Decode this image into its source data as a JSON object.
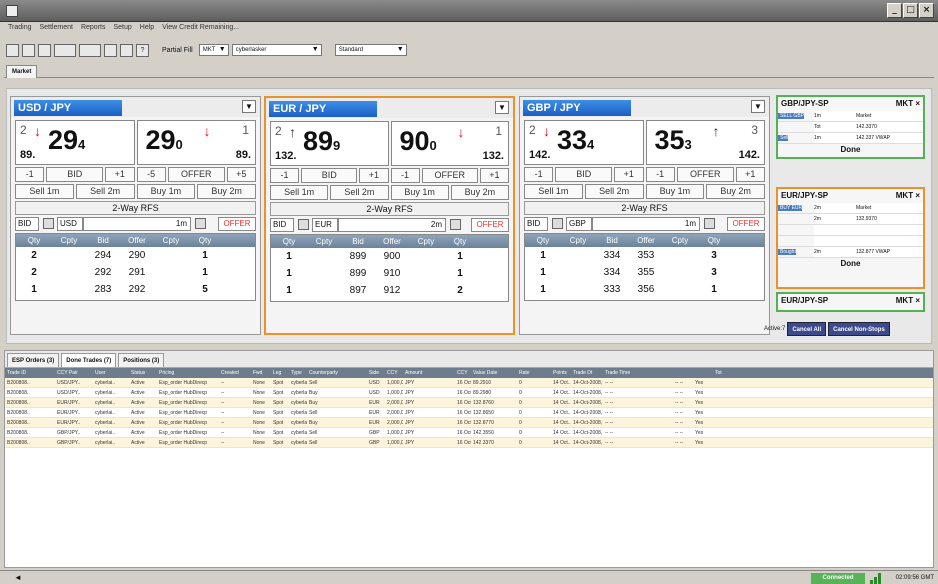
{
  "window": {
    "close": "×",
    "minimize": "_",
    "maximize": "□"
  },
  "menu": [
    "Trading",
    "Settlement",
    "Reports",
    "Setup",
    "Help",
    "View Credit Remaining..."
  ],
  "toolbar": {
    "partial_fill_label": "Partial Fill",
    "partial_fill_value": "MKT",
    "user": "cyberlasker",
    "mode": "Standard"
  },
  "market_tab": "Market",
  "tiles": [
    {
      "pair": "USD / JPY",
      "bid": {
        "top": "2",
        "big": "29",
        "small": "4",
        "base": "89."
      },
      "ask": {
        "top": "1",
        "big": "29",
        "small": "0",
        "base": "89."
      },
      "row1": [
        "-1",
        "BID",
        "+1",
        "-5",
        "OFFER",
        "+5"
      ],
      "row2": [
        "Sell 1m",
        "Sell 2m",
        "Buy 1m",
        "Buy 2m"
      ],
      "rfs": "2-Way RFS",
      "bid_lbl": "BID",
      "ccy": "USD",
      "amt": "1m",
      "offer_lbl": "OFFER",
      "grid_head": [
        "Qty",
        "Cpty",
        "Bid",
        "Offer",
        "Cpty",
        "Qty"
      ],
      "rows": [
        [
          "2",
          "",
          "294",
          "290",
          "",
          "1"
        ],
        [
          "2",
          "",
          "292",
          "291",
          "",
          "1"
        ],
        [
          "1",
          "",
          "283",
          "292",
          "",
          "5"
        ]
      ],
      "bid_dir": "down",
      "ask_dir": "down"
    },
    {
      "pair": "EUR / JPY",
      "bid": {
        "top": "2",
        "big": "89",
        "small": "9",
        "base": "132."
      },
      "ask": {
        "top": "1",
        "big": "90",
        "small": "0",
        "base": "132."
      },
      "row1": [
        "-1",
        "BID",
        "+1",
        "-1",
        "OFFER",
        "+1"
      ],
      "row2": [
        "Sell 1m",
        "Sell 2m",
        "Buy 1m",
        "Buy 2m"
      ],
      "rfs": "2-Way RFS",
      "bid_lbl": "BID",
      "ccy": "EUR",
      "amt": "2m",
      "offer_lbl": "OFFER",
      "grid_head": [
        "Qty",
        "Cpty",
        "Bid",
        "Offer",
        "Cpty",
        "Qty"
      ],
      "rows": [
        [
          "1",
          "",
          "899",
          "900",
          "",
          "1"
        ],
        [
          "1",
          "",
          "899",
          "910",
          "",
          "1"
        ],
        [
          "1",
          "",
          "897",
          "912",
          "",
          "2"
        ]
      ],
      "bid_dir": "up",
      "ask_dir": "down"
    },
    {
      "pair": "GBP / JPY",
      "bid": {
        "top": "2",
        "big": "33",
        "small": "4",
        "base": "142."
      },
      "ask": {
        "top": "3",
        "big": "35",
        "small": "3",
        "base": "142."
      },
      "row1": [
        "-1",
        "BID",
        "+1",
        "-1",
        "OFFER",
        "+1"
      ],
      "row2": [
        "Sell 1m",
        "Sell 2m",
        "Buy 1m",
        "Buy 2m"
      ],
      "rfs": "2-Way RFS",
      "bid_lbl": "BID",
      "ccy": "GBP",
      "amt": "1m",
      "offer_lbl": "OFFER",
      "grid_head": [
        "Qty",
        "Cpty",
        "Bid",
        "Offer",
        "Cpty",
        "Qty"
      ],
      "rows": [
        [
          "1",
          "",
          "334",
          "353",
          "",
          "3"
        ],
        [
          "1",
          "",
          "334",
          "355",
          "",
          "3"
        ],
        [
          "1",
          "",
          "333",
          "356",
          "",
          "1"
        ]
      ],
      "bid_dir": "down",
      "ask_dir": "up"
    }
  ],
  "minis": [
    {
      "title": "GBP/JPY-SP",
      "type": "MKT ×",
      "tag1": "SELL GBP",
      "r1": [
        "1m",
        "Market"
      ],
      "r2": [
        "Tot",
        "142.3370"
      ],
      "tag2": "Sell",
      "r3": [
        "1m",
        "142.337 VWAP"
      ],
      "done": "Done"
    },
    {
      "title": "EUR/JPY-SP",
      "type": "MKT ×",
      "tag1": "BUY EUR",
      "r1": [
        "2m",
        "Market"
      ],
      "r2": [
        "2m",
        "132.9370"
      ],
      "tag2": "Bought",
      "r3": [
        "2m",
        "132.877 VWAP"
      ],
      "done": "Done"
    },
    {
      "title": "EUR/JPY-SP",
      "type": "MKT ×"
    }
  ],
  "actions": {
    "active": "Active:7",
    "cancel_all": "Cancel All",
    "cancel_non_stops": "Cancel Non-Stops"
  },
  "lower_tabs": [
    "ESP Orders (3)",
    "Done Trades (7)",
    "Positions (3)"
  ],
  "trades_head": [
    "Trade ID",
    "CCY Pair",
    "User",
    "Status",
    "Pricing",
    "Created",
    "Fwd",
    "Leg",
    "Type",
    "Counterparty",
    "Side",
    "CCY",
    "Amount",
    "CCY",
    "Value Date",
    "Rate",
    "Points",
    "Trade Dt",
    "Trade Time",
    "",
    "",
    "Tot"
  ],
  "trades": [
    [
      "B200808..",
      "USD/JPY..",
      "cyberlai..",
      "Active",
      "Esp_order HubDirecp",
      "--",
      "None",
      "Spot",
      "cyberlaser Cyber",
      "Sell",
      "USD",
      "1,000,000.00",
      "JPY",
      "16 Oct 2008",
      "89.2910",
      "0",
      "14 Oct..",
      "14-Oct-2008, 02:07..",
      "-- --",
      "-- --",
      "Yes"
    ],
    [
      "B200808..",
      "USD/JPY..",
      "cyberlai..",
      "Active",
      "Esp_order HubDirecp",
      "--",
      "None",
      "Spot",
      "cyberlaser Cyber",
      "Buy",
      "USD",
      "1,000,000.00",
      "JPY",
      "16 Oct 2008",
      "89.2980",
      "0",
      "14 Oct..",
      "14-Oct-2008, 02:08..",
      "-- --",
      "-- --",
      "Yes"
    ],
    [
      "B200808..",
      "EUR/JPY..",
      "cyberlai..",
      "Active",
      "Esp_order HubDirecp",
      "--",
      "None",
      "Spot",
      "cyberlaser Cyber",
      "Buy",
      "EUR",
      "2,000,000.00",
      "JPY",
      "16 Oct 2008",
      "132.8760",
      "0",
      "14 Oct..",
      "14-Oct-2008, 02:08..",
      "-- --",
      "-- --",
      "Yes"
    ],
    [
      "B200808..",
      "EUR/JPY..",
      "cyberlai..",
      "Active",
      "Esp_order HubDirecp",
      "--",
      "None",
      "Spot",
      "cyberlaser Cyber",
      "Sell",
      "EUR",
      "2,000,000.00",
      "JPY",
      "16 Oct 2008",
      "132.8650",
      "0",
      "14 Oct..",
      "14-Oct-2008, 02:08..",
      "-- --",
      "-- --",
      "Yes"
    ],
    [
      "B200808..",
      "EUR/JPY..",
      "cyberlai..",
      "Active",
      "Esp_order HubDirecp",
      "--",
      "None",
      "Spot",
      "cyberlaser Cyber",
      "Buy",
      "EUR",
      "2,000,000.00",
      "JPY",
      "16 Oct 2008",
      "132.8770",
      "0",
      "14 Oct..",
      "14-Oct-2008, 02:09..",
      "-- --",
      "-- --",
      "Yes"
    ],
    [
      "B200808..",
      "GBP/JPY..",
      "cyberlai..",
      "Active",
      "Esp_order HubDirecp",
      "--",
      "None",
      "Spot",
      "cyberlaser Cyber",
      "Sell",
      "GBP",
      "1,000,000.00",
      "JPY",
      "16 Oct 2008",
      "142.3550",
      "0",
      "14 Oct..",
      "14-Oct-2008, 02:09..",
      "-- --",
      "-- --",
      "Yes"
    ],
    [
      "B200808..",
      "GBP/JPY..",
      "cyberlai..",
      "Active",
      "Esp_order HubDirecp",
      "--",
      "None",
      "Spot",
      "cyberlaser Cyber",
      "Sell",
      "GBP",
      "1,000,000.00",
      "JPY",
      "16 Oct 2008",
      "142.3370",
      "0",
      "14 Oct..",
      "14-Oct-2008, 02:09..",
      "-- --",
      "-- --",
      "Yes"
    ]
  ],
  "status": {
    "connected": "Connected",
    "time": "02:09:56 GMT"
  }
}
